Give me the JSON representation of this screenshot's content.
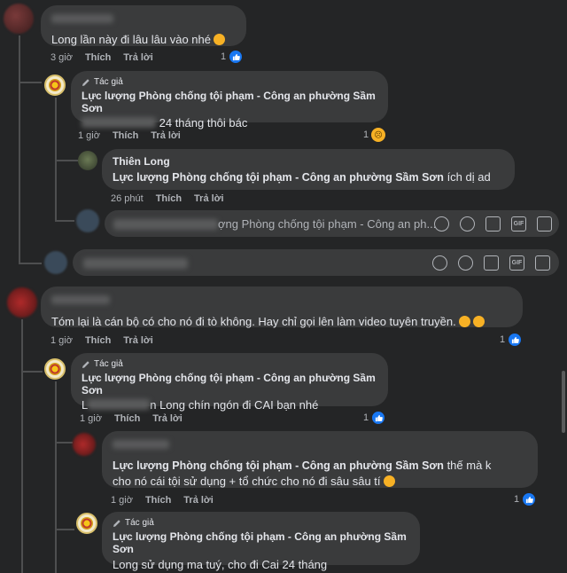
{
  "c1": {
    "text": "Long lần này đi lâu lâu vào nhé",
    "time": "3 giờ",
    "like": "Thích",
    "reply": "Trả lời",
    "reacts": "1"
  },
  "r1": {
    "tag": "Tác giả",
    "name": "Lực lượng Phòng chống tội phạm - Công an phường Sầm Sơn",
    "text": "24 tháng thôi bác",
    "time": "1 giờ",
    "like": "Thích",
    "reply": "Trả lời",
    "reacts": "1"
  },
  "r2": {
    "name": "Thiên Long",
    "mention": "Lực lượng Phòng chống tội phạm - Công an phường Sầm Sơn",
    "text": "ích dị ad",
    "time": "26 phút",
    "like": "Thích",
    "reply": "Trả lời"
  },
  "input1": {
    "placeholder": "ợng Phòng chống tội phạm - Công an ph..."
  },
  "c2": {
    "text": "Tóm lại là cán bộ có cho nó đi tò không. Hay chỉ gọi lên làm video tuyên truyền.",
    "time": "1 giờ",
    "like": "Thích",
    "reply": "Trả lời",
    "reacts": "1"
  },
  "r3": {
    "tag": "Tác giả",
    "name": "Lực lượng Phòng chống tội phạm - Công an phường Sầm Sơn",
    "prefix": "L",
    "text": "n Long chín ngón đi CAI bạn nhé",
    "time": "1 giờ",
    "like": "Thích",
    "reply": "Trả lời",
    "reacts": "1"
  },
  "r4": {
    "mention": "Lực lượng Phòng chống tội phạm - Công an phường Sầm Sơn",
    "text1": "thế mà k",
    "text2": "cho nó cái tội sử dụng + tổ chức cho nó đi sâu sâu tí",
    "time": "1 giờ",
    "like": "Thích",
    "reply": "Trả lời",
    "reacts": "1"
  },
  "r5": {
    "tag": "Tác giả",
    "name": "Lực lượng Phòng chống tội phạm - Công an phường Sầm Sơn",
    "text": "Long sử dụng ma tuý, cho đi Cai 24 tháng"
  },
  "colors": {
    "background": "#242526",
    "bubble": "#3a3b3c",
    "like": "#1877f2",
    "muted": "#b0b3b8"
  }
}
